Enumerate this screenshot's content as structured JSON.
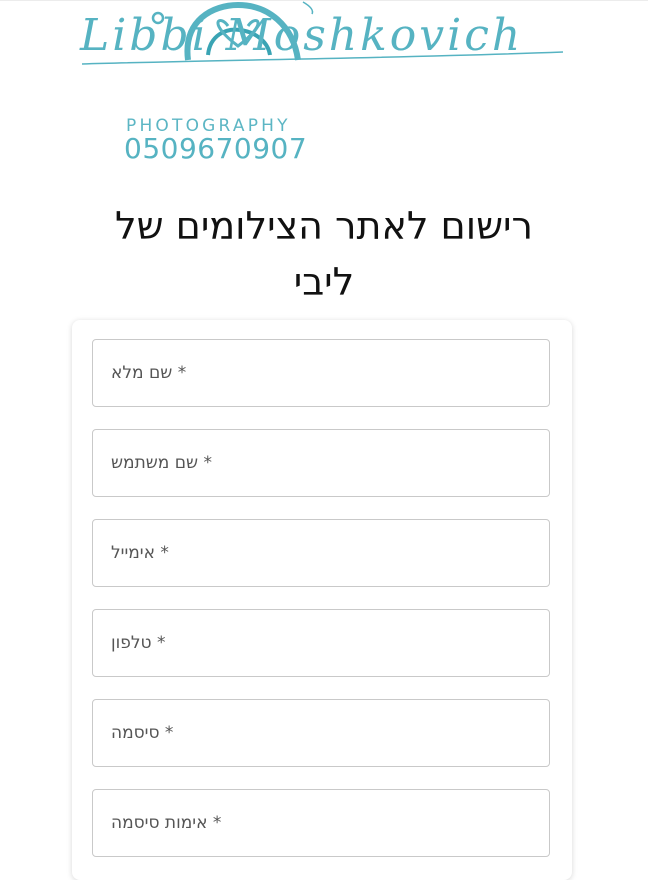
{
  "logo": {
    "script_text": "Libbi Moshkovich",
    "subtitle": "PHOTOGRAPHY",
    "phone": "0509670907",
    "brand_color": "#56b3c2"
  },
  "page_title": "רישום לאתר הצילומים של ליבי",
  "form": {
    "fields": [
      {
        "label": "* שם מלא"
      },
      {
        "label": "* שם משתמש"
      },
      {
        "label": "* אימייל"
      },
      {
        "label": "* טלפון"
      },
      {
        "label": "* סיסמה"
      },
      {
        "label": "* אימות סיסמה"
      }
    ]
  }
}
